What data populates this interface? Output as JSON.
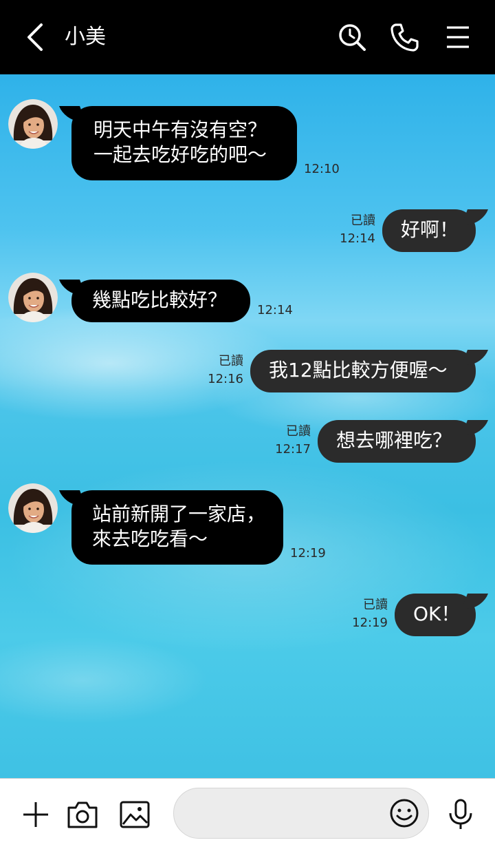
{
  "header": {
    "title": "小美",
    "icons": [
      "back-chevron-icon",
      "search-history-icon",
      "phone-icon",
      "menu-icon"
    ]
  },
  "messages": [
    {
      "from": "friend",
      "lines": [
        "明天中午有沒有空？",
        "一起去吃好吃的吧～"
      ],
      "time": "12:10"
    },
    {
      "from": "me",
      "lines": [
        "好啊！"
      ],
      "time": "12:14",
      "read": "已讀"
    },
    {
      "from": "friend",
      "lines": [
        "幾點吃比較好？"
      ],
      "time": "12:14"
    },
    {
      "from": "me",
      "lines": [
        "我12點比較方便喔～"
      ],
      "time": "12:16",
      "read": "已讀"
    },
    {
      "from": "me",
      "lines": [
        "想去哪裡吃？"
      ],
      "time": "12:17",
      "read": "已讀"
    },
    {
      "from": "friend",
      "lines": [
        "站前新開了一家店，",
        "來去吃吃看～"
      ],
      "time": "12:19"
    },
    {
      "from": "me",
      "lines": [
        "OK！"
      ],
      "time": "12:19",
      "read": "已讀"
    }
  ],
  "footer": {
    "input_placeholder": "",
    "icons": [
      "plus-icon",
      "camera-icon",
      "image-icon",
      "emoji-icon",
      "microphone-icon"
    ]
  },
  "colors": {
    "header_bg": "#000000",
    "incoming_bubble": "#000000",
    "outgoing_bubble": "#2b2b2b",
    "chat_bg": "#3bbfe3"
  }
}
